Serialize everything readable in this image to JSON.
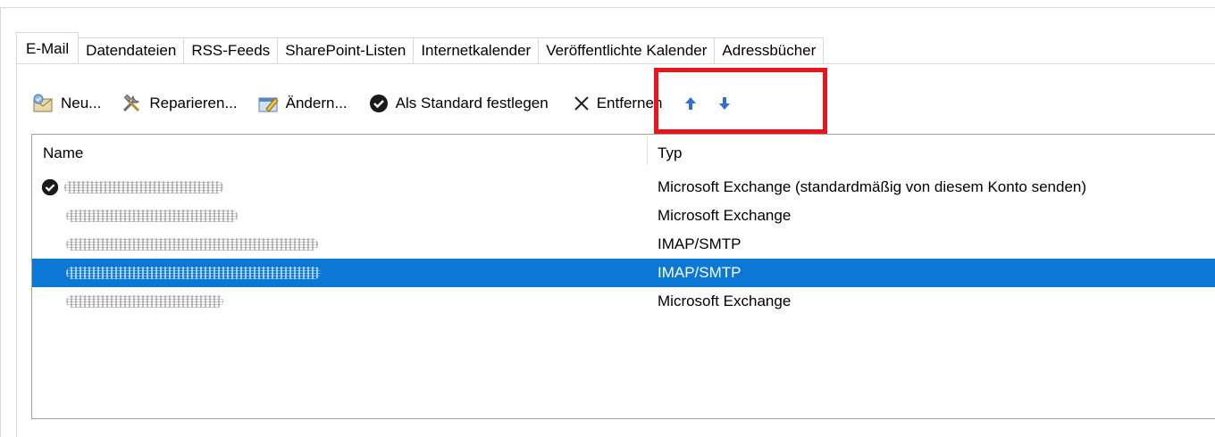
{
  "tabs": [
    {
      "label": "E-Mail",
      "active": true
    },
    {
      "label": "Datendateien"
    },
    {
      "label": "RSS-Feeds"
    },
    {
      "label": "SharePoint-Listen"
    },
    {
      "label": "Internetkalender"
    },
    {
      "label": "Veröffentlichte Kalender"
    },
    {
      "label": "Adressbücher"
    }
  ],
  "toolbar": {
    "new_label": "Neu...",
    "repair_label": "Reparieren...",
    "change_label": "Ändern...",
    "set_default_label": "Als Standard festlegen",
    "remove_label": "Entfernen"
  },
  "list": {
    "col_name": "Name",
    "col_type": "Typ",
    "rows": [
      {
        "type": "Microsoft Exchange (standardmäßig von diesem Konto senden)",
        "default": true
      },
      {
        "type": "Microsoft Exchange"
      },
      {
        "type": "IMAP/SMTP"
      },
      {
        "type": "IMAP/SMTP",
        "selected": true
      },
      {
        "type": "Microsoft Exchange"
      }
    ]
  },
  "colors": {
    "selection": "#0a78d4",
    "highlight": "#e8141e",
    "arrow": "#2f6fd6"
  }
}
